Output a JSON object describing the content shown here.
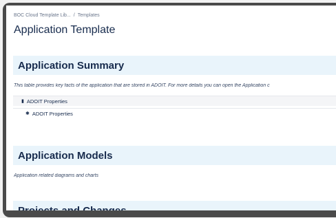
{
  "breadcrumb": {
    "items": [
      "BOC Cloud Template Lib...",
      "Templates"
    ],
    "separator": "/"
  },
  "page_title": "Application Template",
  "sections": [
    {
      "heading": "Application Summary",
      "description": "This table provides key facts of the application that are stored in ADOIT. For more details you can open the Application c"
    },
    {
      "heading": "Application Models",
      "description": "Application related diagrams and charts"
    },
    {
      "heading": "Projects and Changes"
    }
  ],
  "properties": [
    {
      "label": "ADOIT Properties",
      "icon": "document-icon"
    },
    {
      "label": "ADOIT Properties",
      "icon": "puzzle-icon"
    }
  ],
  "colors": {
    "section_band": "#e9f4fb",
    "frame": "#4a4a4a",
    "text": "#172b4d"
  }
}
